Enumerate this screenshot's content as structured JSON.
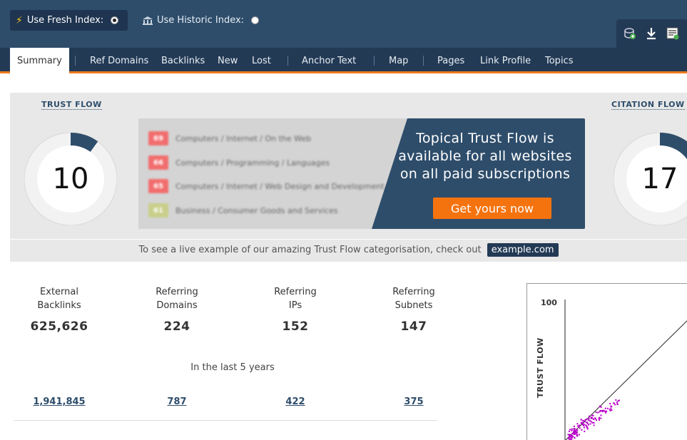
{
  "index_selector": {
    "fresh_label": "Use Fresh Index:",
    "historic_label": "Use Historic Index:",
    "selected": "fresh"
  },
  "toolbox": {
    "icons": [
      "add-to-bucket-icon",
      "download-icon",
      "report-icon"
    ]
  },
  "tabs": [
    {
      "label": "Summary",
      "active": true
    },
    {
      "label": "Ref Domains"
    },
    {
      "label": "Backlinks"
    },
    {
      "label": "New"
    },
    {
      "label": "Lost"
    },
    {
      "label": "Anchor Text"
    },
    {
      "label": "Map"
    },
    {
      "label": "Pages"
    },
    {
      "label": "Link Profile"
    },
    {
      "label": "Topics"
    }
  ],
  "trust_flow": {
    "label": "TRUST FLOW",
    "value": 10
  },
  "citation_flow": {
    "label": "CITATION FLOW",
    "value": 17
  },
  "topical_trust_flow": {
    "rows": [
      {
        "score": "69",
        "category": "Computers / Internet / On the Web",
        "color": "#f26e6e"
      },
      {
        "score": "66",
        "category": "Computers / Programming / Languages",
        "color": "#f26e6e"
      },
      {
        "score": "65",
        "category": "Computers / Internet / Web Design and Development",
        "color": "#f26e6e"
      },
      {
        "score": "61",
        "category": "Business / Consumer Goods and Services",
        "color": "#c9cf8a"
      }
    ],
    "promo_line1": "Topical Trust Flow is",
    "promo_line2": "available for all websites",
    "promo_line3": "on all paid subscriptions",
    "button_label": "Get yours now"
  },
  "example": {
    "text": "To see a live example of our amazing Trust Flow categorisation, check out",
    "link": "example.com"
  },
  "stats": [
    {
      "line1": "External",
      "line2": "Backlinks",
      "value": "625,626",
      "history": "1,941,845"
    },
    {
      "line1": "Referring",
      "line2": "Domains",
      "value": "224",
      "history": "787"
    },
    {
      "line1": "Referring",
      "line2": "IPs",
      "value": "152",
      "history": "422"
    },
    {
      "line1": "Referring",
      "line2": "Subnets",
      "value": "147",
      "history": "375"
    }
  ],
  "history_caption": "In the last 5 years",
  "chart": {
    "y_max_label": "100",
    "y_axis_label": "TRUST FLOW"
  },
  "colors": {
    "header": "#2e4d6b",
    "tabbar": "#233a55",
    "accent": "#f07b1a",
    "gauge_fill": "#2e4d6b",
    "scatter_dots": "#b800c8"
  }
}
